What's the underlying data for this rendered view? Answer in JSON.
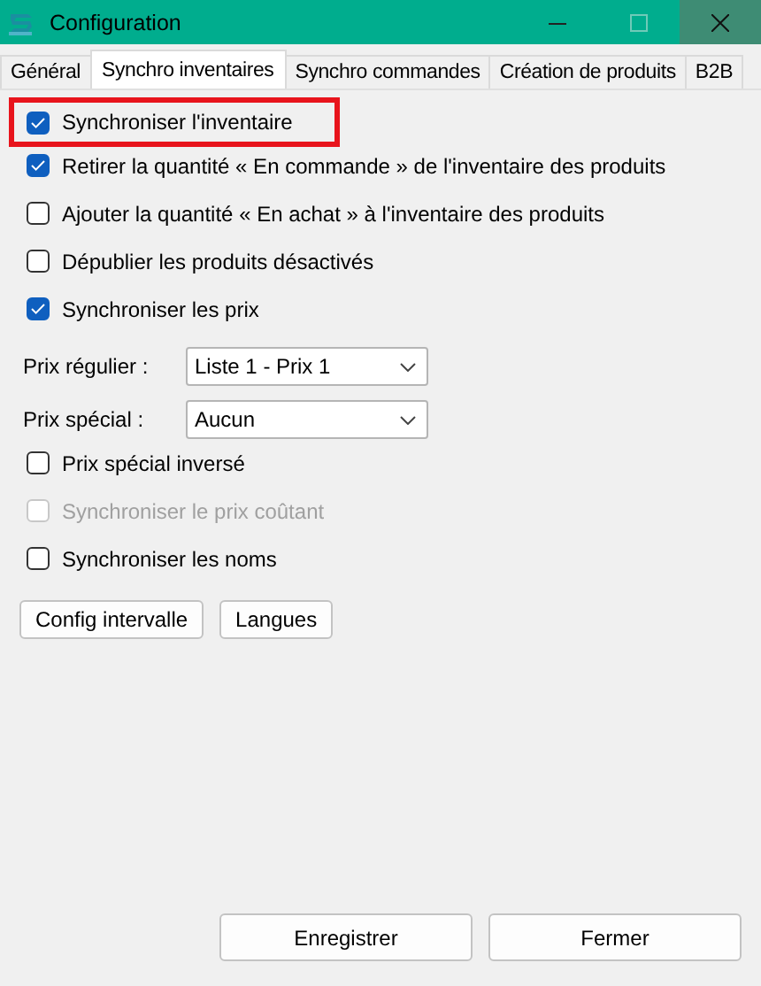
{
  "window": {
    "title": "Configuration"
  },
  "tabs": [
    {
      "label": "Général",
      "selected": false
    },
    {
      "label": "Synchro inventaires",
      "selected": true
    },
    {
      "label": "Synchro commandes",
      "selected": false
    },
    {
      "label": "Création de produits",
      "selected": false
    },
    {
      "label": "B2B",
      "selected": false
    }
  ],
  "options": [
    {
      "kind": "checkbox",
      "label": "Synchroniser l'inventaire",
      "checked": true,
      "disabled": false,
      "highlighted": true
    },
    {
      "kind": "checkbox",
      "label": "Retirer la quantité « En commande » de l'inventaire des produits",
      "checked": true,
      "disabled": false,
      "highlighted": false
    },
    {
      "kind": "checkbox",
      "label": "Ajouter la quantité « En achat » à l'inventaire des produits",
      "checked": false,
      "disabled": false,
      "highlighted": false
    },
    {
      "kind": "checkbox",
      "label": "Dépublier les produits désactivés",
      "checked": false,
      "disabled": false,
      "highlighted": false
    },
    {
      "kind": "checkbox",
      "label": "Synchroniser les prix",
      "checked": true,
      "disabled": false,
      "highlighted": false
    },
    {
      "kind": "select",
      "label": "Prix régulier :",
      "value": "Liste 1 - Prix 1"
    },
    {
      "kind": "select",
      "label": "Prix spécial :",
      "value": "Aucun"
    },
    {
      "kind": "checkbox",
      "label": "Prix spécial inversé",
      "checked": false,
      "disabled": false,
      "highlighted": false
    },
    {
      "kind": "checkbox",
      "label": "Synchroniser le prix coûtant",
      "checked": false,
      "disabled": true,
      "highlighted": false
    },
    {
      "kind": "checkbox",
      "label": "Synchroniser les noms",
      "checked": false,
      "disabled": false,
      "highlighted": false
    }
  ],
  "tab_buttons": [
    "Config intervalle",
    "Langues"
  ],
  "footer_buttons": [
    "Enregistrer",
    "Fermer"
  ]
}
